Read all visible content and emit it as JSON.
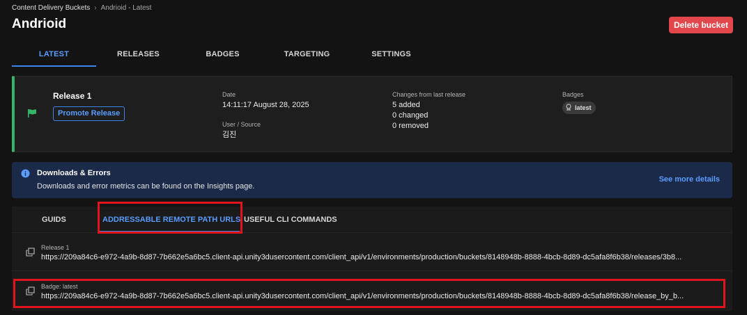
{
  "breadcrumb": {
    "parent": "Content Delivery Buckets",
    "separator": "›",
    "current": "Andrioid - Latest"
  },
  "header": {
    "title": "Andrioid",
    "delete_label": "Delete bucket"
  },
  "main_tabs": [
    {
      "label": "LATEST",
      "active": true
    },
    {
      "label": "RELEASES"
    },
    {
      "label": "BADGES"
    },
    {
      "label": "TARGETING"
    },
    {
      "label": "SETTINGS"
    }
  ],
  "release": {
    "name": "Release 1",
    "promote_label": "Promote Release",
    "date_label": "Date",
    "date_value": "14:11:17 August 28, 2025",
    "user_label": "User / Source",
    "user_value": "김진",
    "changes_label": "Changes from last release",
    "changes": [
      "5 added",
      "0 changed",
      "0 removed"
    ],
    "badges_label": "Badges",
    "badge": "latest"
  },
  "info": {
    "title": "Downloads & Errors",
    "description": "Downloads and error metrics can be found on the Insights page.",
    "link": "See more details"
  },
  "sub_tabs": [
    {
      "label": "GUIDS"
    },
    {
      "label": "ADDRESSABLE REMOTE PATH URLS",
      "active": true
    },
    {
      "label": "USEFUL CLI COMMANDS"
    }
  ],
  "urls": [
    {
      "label": "Release 1",
      "value": "https://209a84c6-e972-4a9b-8d87-7b662e5a6bc5.client-api.unity3dusercontent.com/client_api/v1/environments/production/buckets/8148948b-8888-4bcb-8d89-dc5afa8f6b38/releases/3b8..."
    },
    {
      "label": "Badge: latest",
      "value": "https://209a84c6-e972-4a9b-8d87-7b662e5a6bc5.client-api.unity3dusercontent.com/client_api/v1/environments/production/buckets/8148948b-8888-4bcb-8d89-dc5afa8f6b38/release_by_b..."
    }
  ],
  "colors": {
    "accent": "#3d86f2",
    "danger": "#e2474c",
    "success": "#34b567",
    "highlight": "#e0141c"
  }
}
